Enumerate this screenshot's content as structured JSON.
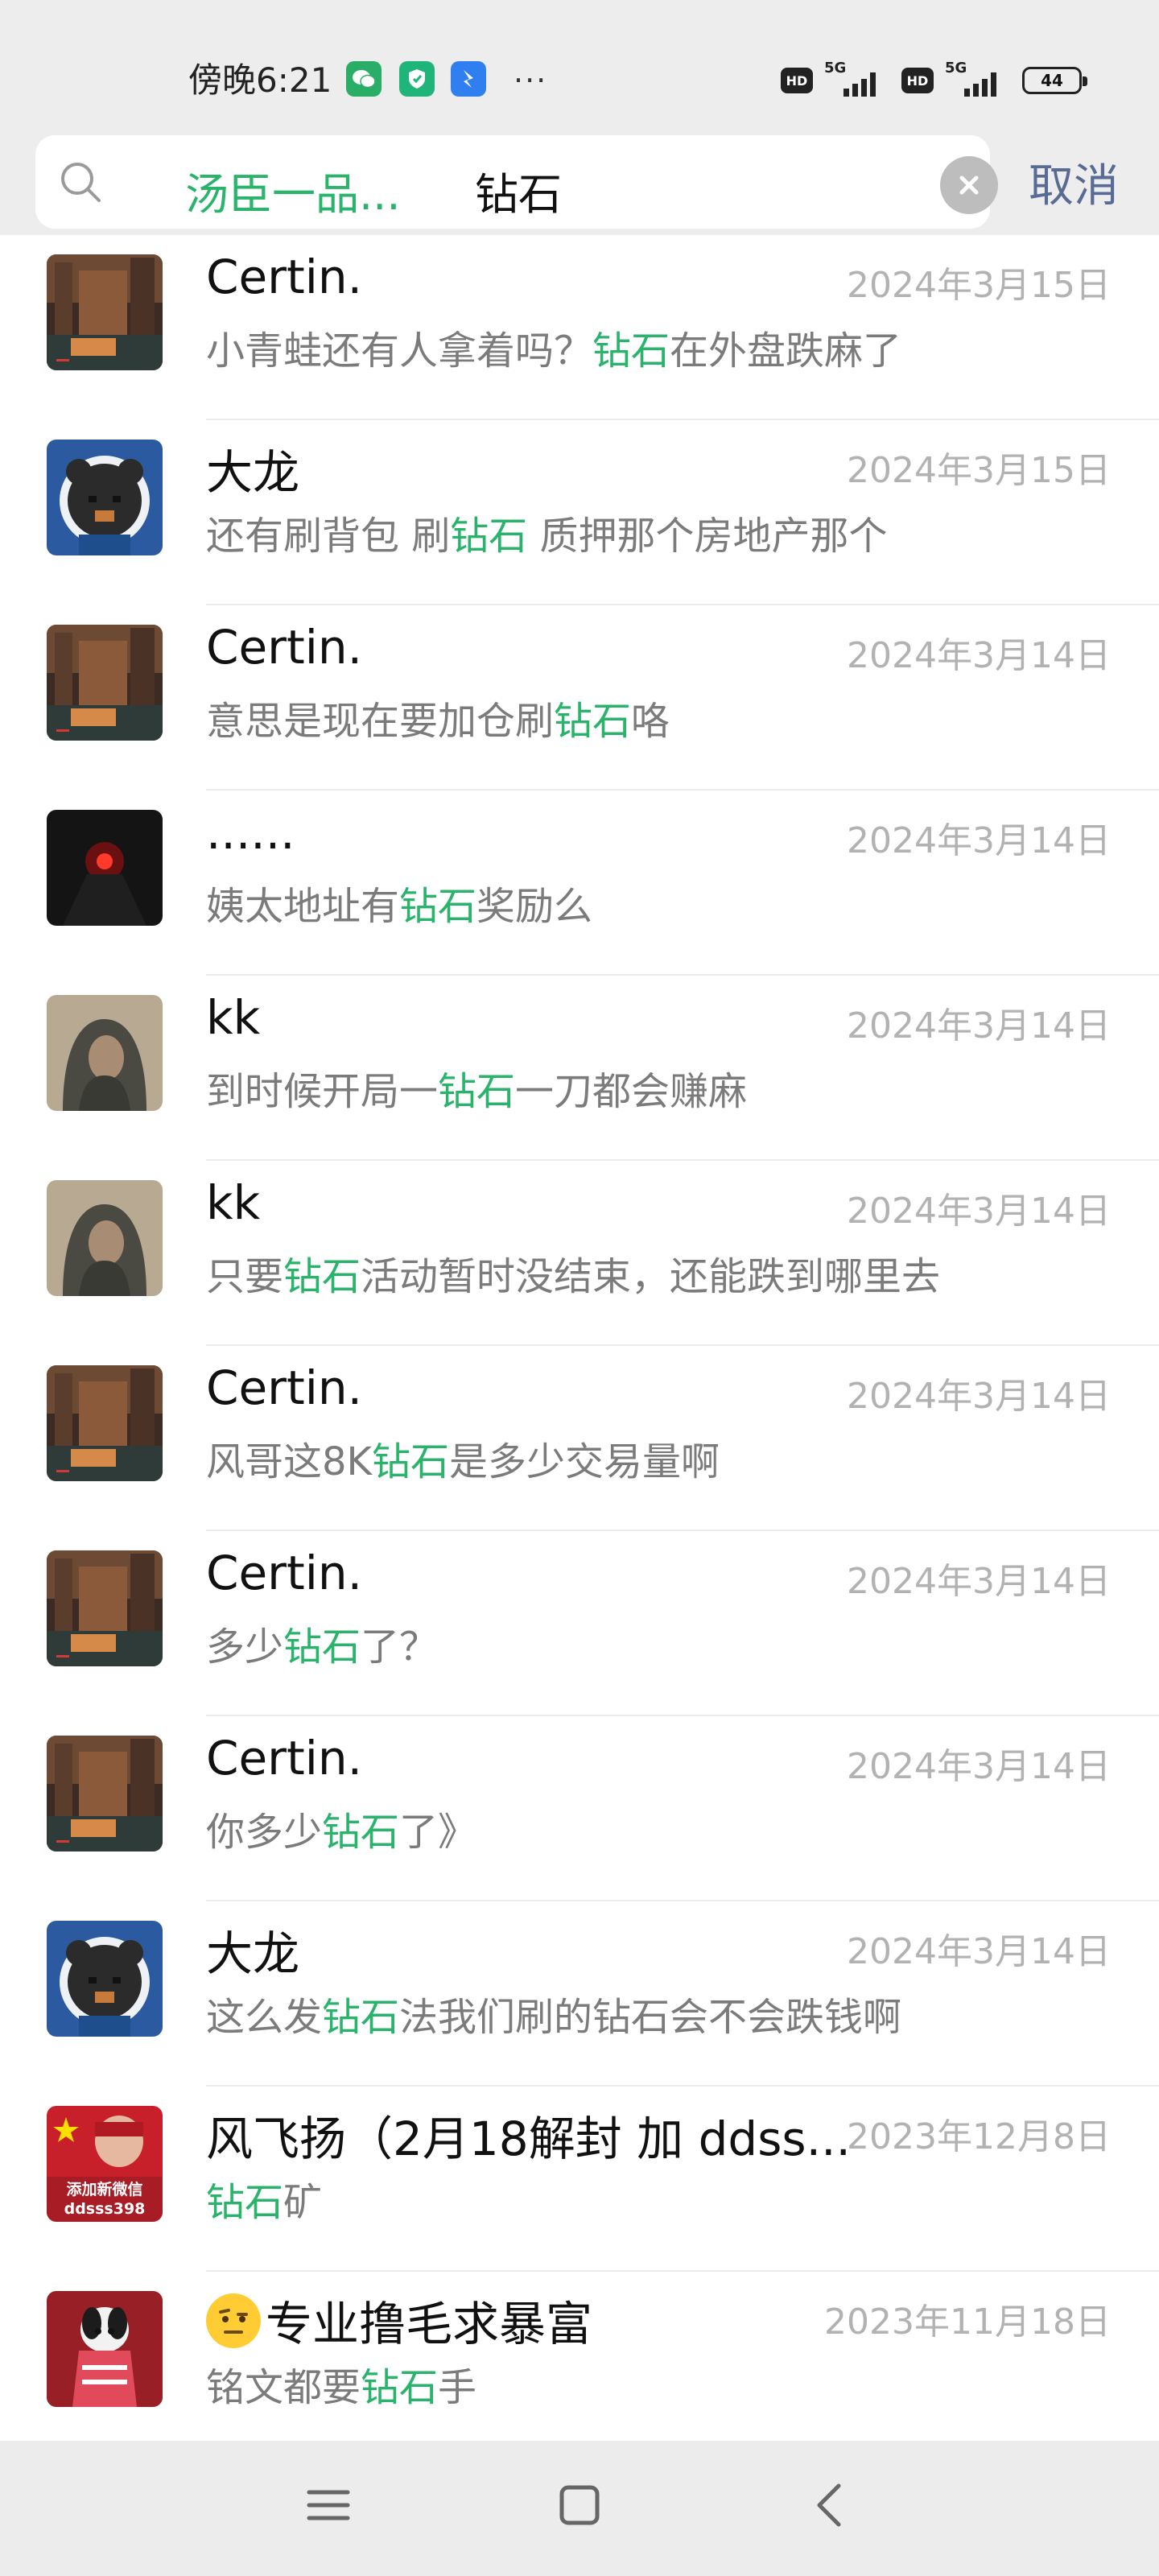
{
  "status_bar": {
    "time": "傍晚6:21",
    "more": "···",
    "hd1": "HD",
    "signal1": "5G",
    "hd2": "HD",
    "signal2": "5G",
    "battery": "44"
  },
  "search": {
    "chip": "汤臣一品...",
    "query": "钻石",
    "cancel_label": "取消"
  },
  "colors": {
    "highlight": "#2ab36a",
    "cancel": "#576b95",
    "date": "#b2b2b2"
  },
  "results": [
    {
      "name": "Certin.",
      "date": "2024年3月15日",
      "snippet_pre": "小青蛙还有人拿着吗？",
      "snippet_hl": "钻石",
      "snippet_post": "在外盘跌麻了",
      "avatar": "city-street"
    },
    {
      "name": "大龙",
      "date": "2024年3月15日",
      "snippet_pre": "还有刷背包  刷",
      "snippet_hl": "钻石",
      "snippet_post": "  质押那个房地产那个",
      "avatar": "pixel-mouse"
    },
    {
      "name": "Certin.",
      "date": "2024年3月14日",
      "snippet_pre": "意思是现在要加仓刷",
      "snippet_hl": "钻石",
      "snippet_post": "咯",
      "avatar": "city-street"
    },
    {
      "name": "......",
      "date": "2024年3月14日",
      "snippet_pre": "姨太地址有",
      "snippet_hl": "钻石",
      "snippet_post": "奖励么",
      "avatar": "dark-red-light"
    },
    {
      "name": "kk",
      "date": "2024年3月14日",
      "snippet_pre": "到时候开局一",
      "snippet_hl": "钻石",
      "snippet_post": "一刀都会赚麻",
      "avatar": "hooded-figure"
    },
    {
      "name": "kk",
      "date": "2024年3月14日",
      "snippet_pre": "只要",
      "snippet_hl": "钻石",
      "snippet_post": "活动暂时没结束，还能跌到哪里去",
      "avatar": "hooded-figure"
    },
    {
      "name": "Certin.",
      "date": "2024年3月14日",
      "snippet_pre": "风哥这8K",
      "snippet_hl": "钻石",
      "snippet_post": "是多少交易量啊",
      "avatar": "city-street"
    },
    {
      "name": "Certin.",
      "date": "2024年3月14日",
      "snippet_pre": "多少",
      "snippet_hl": "钻石",
      "snippet_post": "了？",
      "avatar": "city-street"
    },
    {
      "name": "Certin.",
      "date": "2024年3月14日",
      "snippet_pre": "你多少",
      "snippet_hl": "钻石",
      "snippet_post": "了》",
      "avatar": "city-street"
    },
    {
      "name": "大龙",
      "date": "2024年3月14日",
      "snippet_pre": "这么发",
      "snippet_hl": "钻石",
      "snippet_post": "法我们刷的钻石会不会跌钱啊",
      "avatar": "pixel-mouse"
    },
    {
      "name": "风飞扬（2月18解封 加 ddss...",
      "date": "2023年12月8日",
      "snippet_pre": "",
      "snippet_hl": "钻石",
      "snippet_post": "矿",
      "avatar": "red-flag-text",
      "avatar_text1": "添加新微信",
      "avatar_text2": "ddsss398"
    },
    {
      "name": "专业撸毛求暴富",
      "date": "2023年11月18日",
      "snippet_pre": "铭文都要",
      "snippet_hl": "钻石",
      "snippet_post": "手",
      "avatar": "dog-red-sweater",
      "emoji": "raised-eyebrow-face"
    }
  ]
}
